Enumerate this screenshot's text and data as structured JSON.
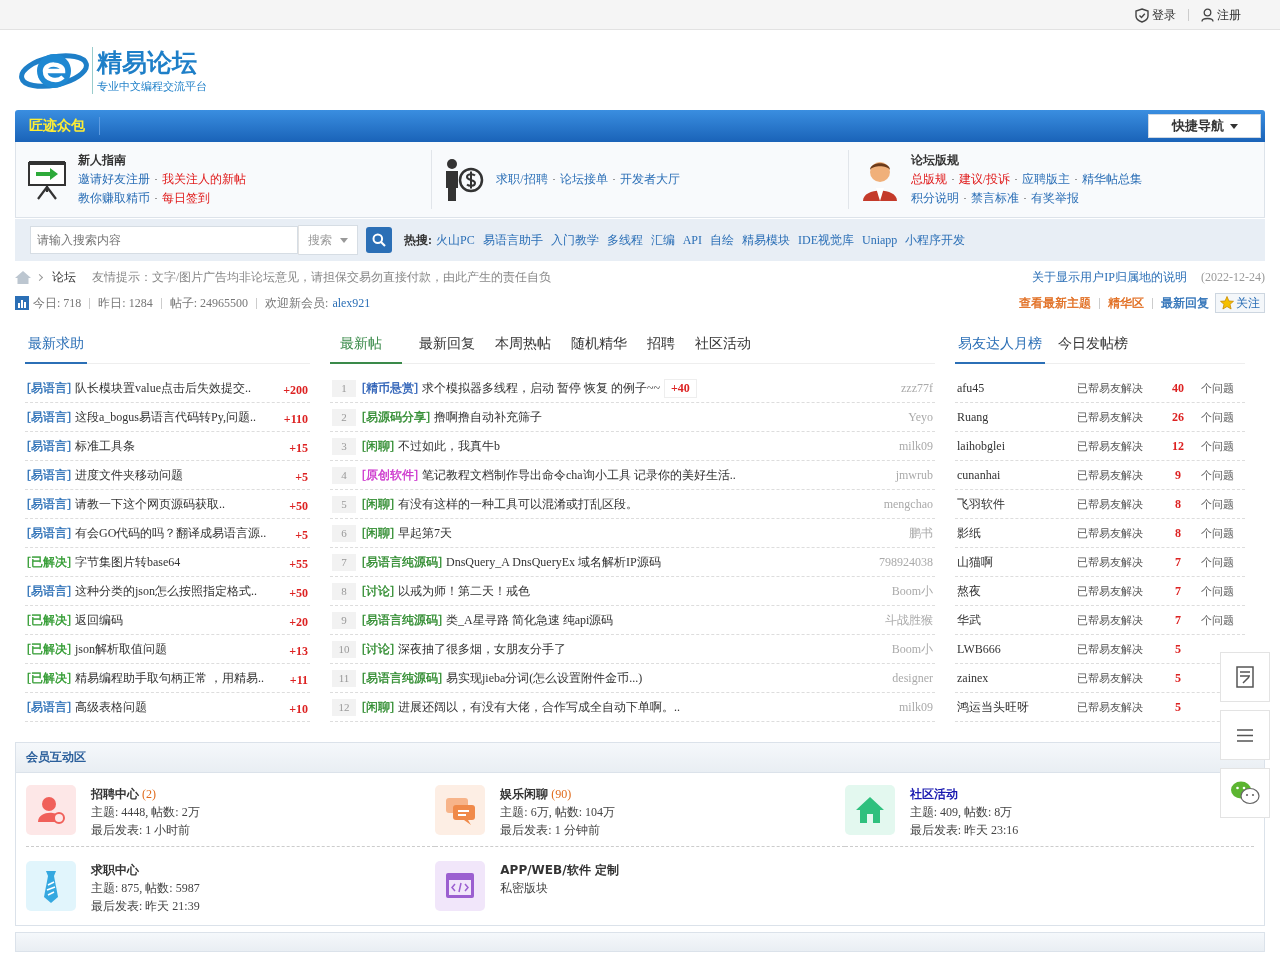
{
  "top_bar": {
    "links": [
      {
        "label": "登录",
        "kind": "login"
      },
      {
        "label": "注册",
        "kind": "register"
      }
    ]
  },
  "logo": {
    "title": "精易论坛",
    "subtitle": "专业中文编程交流平台"
  },
  "nav": {
    "brand": "匠迹众包",
    "quick_nav": "快捷导航"
  },
  "guides": [
    {
      "kind": "board",
      "title": "新人指南",
      "lines": [
        [
          {
            "label": "邀请好友注册",
            "hot": false
          },
          {
            "label": "我关注人的新帖",
            "hot": true
          }
        ],
        [
          {
            "label": "教你赚取精币",
            "hot": false
          },
          {
            "label": "每日签到",
            "hot": true
          }
        ]
      ]
    },
    {
      "kind": "money",
      "lines": [
        [
          {
            "label": "求职/招聘",
            "hot": false
          },
          {
            "label": "论坛接单",
            "hot": false
          },
          {
            "label": "开发者大厅",
            "hot": false
          }
        ]
      ]
    },
    {
      "kind": "person",
      "title": "论坛版规",
      "lines": [
        [
          {
            "label": "总版规",
            "hot": true
          },
          {
            "label": "建议/投诉",
            "hot": true
          },
          {
            "label": "应聘版主",
            "hot": false
          },
          {
            "label": "精华帖总集",
            "hot": false
          }
        ],
        [
          {
            "label": "积分说明",
            "hot": false
          },
          {
            "label": "禁言标准",
            "hot": false
          },
          {
            "label": "有奖举报",
            "hot": false
          }
        ]
      ]
    }
  ],
  "search": {
    "placeholder": "请输入搜索内容",
    "type": "搜索",
    "hot_label": "热搜:",
    "hot_terms": [
      "火山PC",
      "易语言助手",
      "入门教学",
      "多线程",
      "汇编",
      "API",
      "自绘",
      "精易模块",
      "IDE视觉库",
      "Uniapp",
      "小程序开发"
    ]
  },
  "notice": {
    "crumb": "论坛",
    "tip": "友情提示：文字/图片广告均非论坛意见，请担保交易勿直接付款，由此产生的责任自负",
    "link": "关于显示用户IP归属地的说明",
    "date": "(2022-12-24)"
  },
  "stats": {
    "items": [
      {
        "label": "今日:",
        "value": "718"
      },
      {
        "label": "昨日:",
        "value": "1284"
      },
      {
        "label": "帖子:",
        "value": "24965500"
      }
    ],
    "welcome": "欢迎新会员:",
    "member": "alex921",
    "links": [
      {
        "label": "查看最新主题",
        "color": "#e06a1b"
      },
      {
        "label": "精华区",
        "color": "#e06a1b"
      },
      {
        "label": "最新回复",
        "color": "#2b6fb6"
      }
    ],
    "follow": "关注"
  },
  "help": {
    "tabs": [
      {
        "label": "最新求助",
        "selected": true
      }
    ],
    "rows": [
      {
        "tag": "[易语言]",
        "color": "#2b6fb6",
        "title": "队长模块置value点击后失效提交..",
        "points": "+200"
      },
      {
        "tag": "[易语言]",
        "color": "#2b6fb6",
        "title": "这段a_bogus易语言代码转Py,问题..",
        "points": "+110"
      },
      {
        "tag": "[易语言]",
        "color": "#2b6fb6",
        "title": "标准工具条",
        "points": "+15"
      },
      {
        "tag": "[易语言]",
        "color": "#2b6fb6",
        "title": "进度文件夹移动问题",
        "points": "+5"
      },
      {
        "tag": "[易语言]",
        "color": "#2b6fb6",
        "title": "请教一下这个网页源码获取..",
        "points": "+50"
      },
      {
        "tag": "[易语言]",
        "color": "#2b6fb6",
        "title": "有会GO代码的吗？翻译成易语言源..",
        "points": "+5"
      },
      {
        "tag": "[已解决]",
        "color": "#2e9a2e",
        "title": "字节集图片转base64",
        "points": "+55"
      },
      {
        "tag": "[易语言]",
        "color": "#2b6fb6",
        "title": "这种分类的json怎么按照指定格式..",
        "points": "+50"
      },
      {
        "tag": "[已解决]",
        "color": "#2e9a2e",
        "title": "返回编码",
        "points": "+20"
      },
      {
        "tag": "[已解决]",
        "color": "#2e9a2e",
        "title": "json解析取值问题",
        "points": "+13"
      },
      {
        "tag": "[已解决]",
        "color": "#2e9a2e",
        "title": "精易编程助手取句柄正常 ，用精易..",
        "points": "+11"
      },
      {
        "tag": "[易语言]",
        "color": "#2b6fb6",
        "title": "高级表格问题",
        "points": "+10"
      }
    ]
  },
  "posts": {
    "tabs": [
      {
        "label": "最新帖",
        "selected": true
      },
      {
        "label": "最新回复",
        "selected": false
      },
      {
        "label": "本周热帖",
        "selected": false
      },
      {
        "label": "随机精华",
        "selected": false
      },
      {
        "label": "招聘",
        "selected": false
      },
      {
        "label": "社区活动",
        "selected": false
      }
    ],
    "rows": [
      {
        "rank": "1",
        "tag": "[精币悬赏]",
        "color": "#2b5fb6",
        "title": "求个模拟器多线程，启动 暂停 恢复 的例子~~",
        "bonus": "+40",
        "author": "zzz77f"
      },
      {
        "rank": "2",
        "tag": "[易源码分享]",
        "color": "#2e8b2e",
        "title": "撸啊撸自动补充筛子",
        "author": "Yeyo"
      },
      {
        "rank": "3",
        "tag": "[闲聊]",
        "color": "#2e8b2e",
        "title": "不过如此，我真牛b",
        "author": "milk09"
      },
      {
        "rank": "4",
        "tag": "[原创软件]",
        "color": "#cc33cc",
        "title": "笔记教程文档制作导出命令cha询小工具 记录你的美好生活..",
        "author": "jmwrub"
      },
      {
        "rank": "5",
        "tag": "[闲聊]",
        "color": "#2e8b2e",
        "title": "有没有这样的一种工具可以混淆或打乱区段。",
        "author": "mengchao"
      },
      {
        "rank": "6",
        "tag": "[闲聊]",
        "color": "#2e8b2e",
        "title": "早起第7天",
        "author": "鹏书"
      },
      {
        "rank": "7",
        "tag": "[易语言纯源码]",
        "color": "#2e8b2e",
        "title": "DnsQuery_A DnsQueryEx 域名解析IP源码",
        "author": "798924038"
      },
      {
        "rank": "8",
        "tag": "[讨论]",
        "color": "#2e8b2e",
        "title": "以戒为师！第二天！戒色",
        "author": "Boom小"
      },
      {
        "rank": "9",
        "tag": "[易语言纯源码]",
        "color": "#2e8b2e",
        "title": "类_A星寻路 简化急速 纯api源码",
        "author": "斗战胜猴"
      },
      {
        "rank": "10",
        "tag": "[讨论]",
        "color": "#2e8b2e",
        "title": "深夜抽了很多烟，女朋友分手了",
        "author": "Boom小"
      },
      {
        "rank": "11",
        "tag": "[易语言纯源码]",
        "color": "#2e8b2e",
        "title": "易实现jieba分词(怎么设置附件金币...)",
        "author": "designer"
      },
      {
        "rank": "12",
        "tag": "[闲聊]",
        "color": "#2e8b2e",
        "title": "进展还阔以，有没有大佬，合作写成全自动下单啊。..",
        "author": "milk09"
      }
    ]
  },
  "ranking": {
    "tabs": [
      {
        "label": "易友达人月榜",
        "selected": true
      },
      {
        "label": "今日发帖榜",
        "selected": false
      }
    ],
    "rows": [
      {
        "name": "afu45",
        "text": "已帮易友解决",
        "count": "40",
        "suffix": "个问题"
      },
      {
        "name": "Ruang",
        "text": "已帮易友解决",
        "count": "26",
        "suffix": "个问题"
      },
      {
        "name": "laihobglei",
        "text": "已帮易友解决",
        "count": "12",
        "suffix": "个问题"
      },
      {
        "name": "cunanhai",
        "text": "已帮易友解决",
        "count": "9",
        "suffix": "个问题"
      },
      {
        "name": "飞羽软件",
        "text": "已帮易友解决",
        "count": "8",
        "suffix": "个问题"
      },
      {
        "name": "影纸",
        "text": "已帮易友解决",
        "count": "8",
        "suffix": "个问题"
      },
      {
        "name": "山猫啊",
        "text": "已帮易友解决",
        "count": "7",
        "suffix": "个问题"
      },
      {
        "name": "熬夜",
        "text": "已帮易友解决",
        "count": "7",
        "suffix": "个问题"
      },
      {
        "name": "华武",
        "text": "已帮易友解决",
        "count": "7",
        "suffix": "个问题"
      },
      {
        "name": "LWB666",
        "text": "已帮易友解决",
        "count": "5"
      },
      {
        "name": "zainex",
        "text": "已帮易友解决",
        "count": "5"
      },
      {
        "name": "鸿运当头旺呀",
        "text": "已帮易友解决",
        "count": "5"
      }
    ]
  },
  "member_area": {
    "title": "会员互动区",
    "forums": [
      {
        "kind": "recruit",
        "name": "招聘中心",
        "count": "(2)",
        "link": false,
        "lines": [
          "主题: 4448, 帖数: 2万",
          "最后发表: 1 小时前"
        ]
      },
      {
        "kind": "chat",
        "name": "娱乐闲聊",
        "count": "(90)",
        "link": false,
        "lines": [
          "主题: 6万, 帖数: 104万",
          "最后发表: 1 分钟前"
        ]
      },
      {
        "kind": "home",
        "name": "社区活动",
        "link": true,
        "lines": [
          "主题: 409, 帖数: 8万",
          "最后发表: 昨天 23:16"
        ]
      },
      {
        "kind": "job",
        "name": "求职中心",
        "link": false,
        "lines": [
          "主题: 875, 帖数: 5987",
          "最后发表: 昨天 21:39"
        ]
      },
      {
        "kind": "code",
        "name": "APP/WEB/软件 定制",
        "link": false,
        "lines": [
          "私密版块"
        ]
      }
    ]
  }
}
